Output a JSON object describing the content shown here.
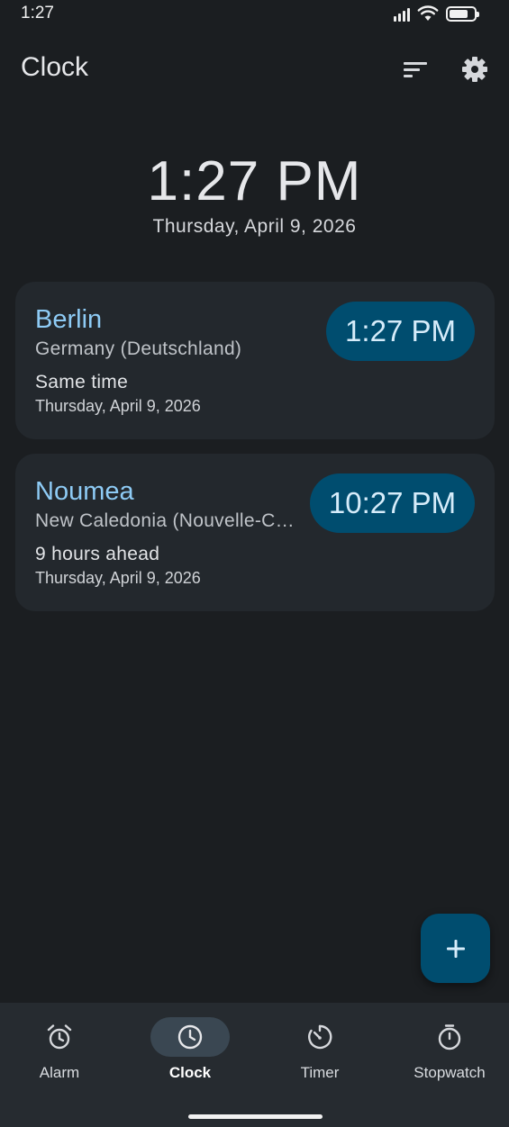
{
  "status_bar": {
    "time": "1:27"
  },
  "app_bar": {
    "title": "Clock"
  },
  "main_clock": {
    "time": "1:27 PM",
    "date": "Thursday, April 9, 2026"
  },
  "cities": [
    {
      "name": "Berlin",
      "country": "Germany (Deutschland)",
      "offset": "Same time",
      "date": "Thursday, April 9, 2026",
      "time": "1:27 PM"
    },
    {
      "name": "Noumea",
      "country": "New Caledonia (Nouvelle-C…",
      "offset": "9 hours ahead",
      "date": "Thursday, April 9, 2026",
      "time": "10:27 PM"
    }
  ],
  "fab": {
    "icon": "plus-icon"
  },
  "bottom_nav": {
    "items": [
      {
        "label": "Alarm",
        "icon": "alarm-icon",
        "active": false
      },
      {
        "label": "Clock",
        "icon": "clock-icon",
        "active": true
      },
      {
        "label": "Timer",
        "icon": "timer-icon",
        "active": false
      },
      {
        "label": "Stopwatch",
        "icon": "stopwatch-icon",
        "active": false
      }
    ]
  },
  "colors": {
    "background": "#1b1e21",
    "card": "#23282d",
    "accent_text": "#8ecbf5",
    "pill": "#004d6f",
    "nav_background": "#262b30",
    "nav_active": "#3a4752"
  }
}
